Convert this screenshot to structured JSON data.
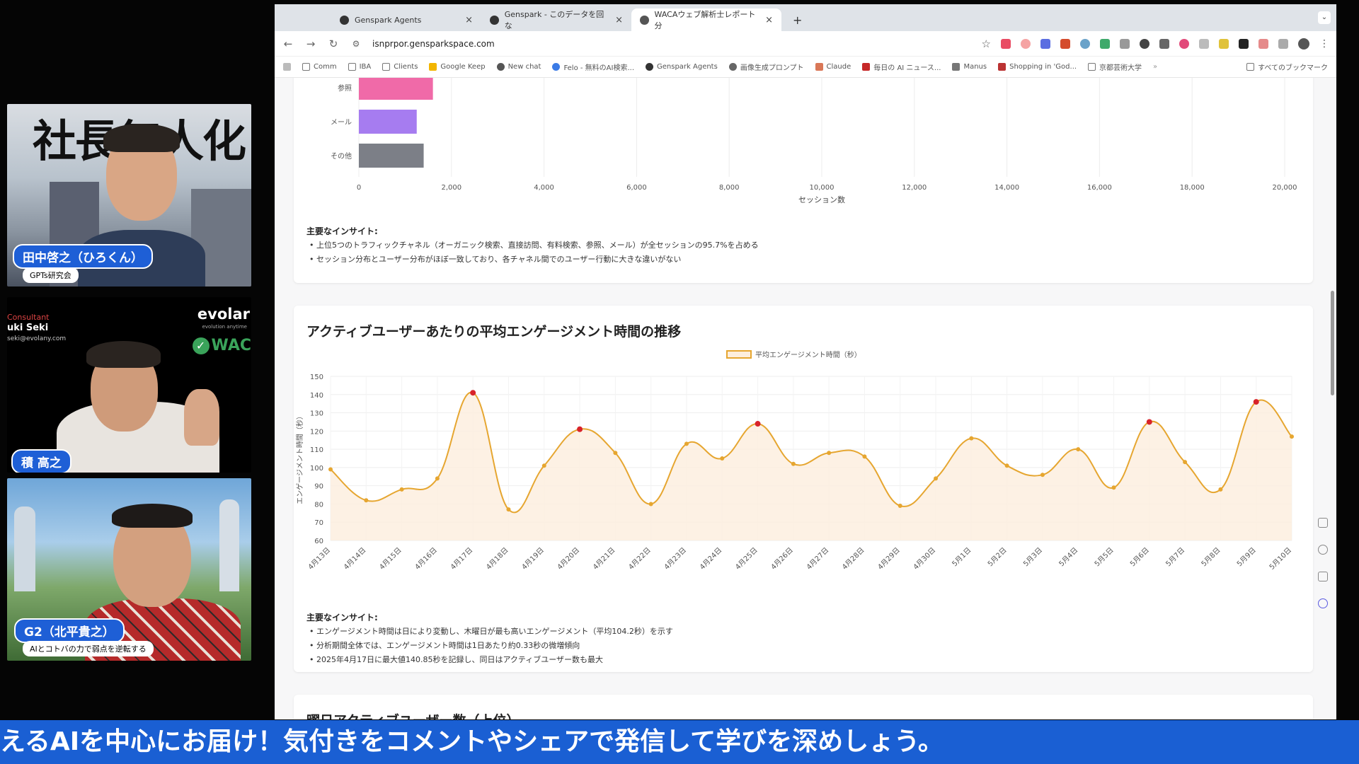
{
  "participants": [
    {
      "name": "田中啓之（ひろくん）",
      "subtitle": "GPTs研究会",
      "bg_text": "社長無人化"
    },
    {
      "name": "積 高之",
      "brand": "evolar",
      "brand_tagline": "evolution anytime",
      "role": "Consultant",
      "person": "uki Seki",
      "email": "seki@evolany.com",
      "wac": "WAC"
    },
    {
      "name": "G2（北平貴之）",
      "subtitle": "AIとコトバの力で弱点を逆転する"
    }
  ],
  "browser": {
    "tabs": [
      {
        "label": "Genspark Agents",
        "active": false
      },
      {
        "label": "Genspark - このデータを回な",
        "active": false
      },
      {
        "label": "WACAウェブ解析士レポート分",
        "active": true
      }
    ],
    "new_tab": "+",
    "url": "isnprpor.gensparkspace.com",
    "bookmarks": [
      "Comm",
      "IBA",
      "Clients",
      "Google Keep",
      "New chat",
      "Felo - 無料のAI検索...",
      "Genspark Agents",
      "画像生成プロンプト",
      "Claude",
      "毎日の AI ニュース...",
      "Manus",
      "Shopping in 'God...",
      "京都芸術大学",
      "すべてのブックマーク"
    ]
  },
  "card1": {
    "insight_title": "主要なインサイト:",
    "insights": [
      "上位5つのトラフィックチャネル（オーガニック検索、直接訪問、有料検索、参照、メール）が全セッションの95.7%を占める",
      "セッション分布とユーザー分布がほぼ一致しており、各チャネル間でのユーザー行動に大きな違いがない"
    ]
  },
  "card2": {
    "title": "アクティブユーザーあたりの平均エンゲージメント時間の推移",
    "insight_title": "主要なインサイト:",
    "insights": [
      "エンゲージメント時間は日により変動し、木曜日が最も高いエンゲージメント（平均104.2秒）を示す",
      "分析期間全体では、エンゲージメント時間は1日あたり約0.33秒の微増傾向",
      "2025年4月17日に最大値140.85秒を記録し、同日はアクティブユーザー数も最大"
    ]
  },
  "card3": {
    "title": "曜日アクティブユーザー数（上位）"
  },
  "ticker": "えるAIを中心にお届け！気付きをコメントやシェアで発信して学びを深めしょう。",
  "chart_data": [
    {
      "type": "bar",
      "orientation": "horizontal",
      "categories": [
        "参照",
        "メール",
        "その他"
      ],
      "values": [
        1600,
        1250,
        1400
      ],
      "colors": [
        "#f06aa8",
        "#a67cf0",
        "#7c7f87"
      ],
      "xlabel": "セッション数",
      "xlim": [
        0,
        20000
      ],
      "xticks": [
        "0",
        "2,000",
        "4,000",
        "6,000",
        "8,000",
        "10,000",
        "12,000",
        "14,000",
        "16,000",
        "18,000",
        "20,000"
      ],
      "grid": true
    },
    {
      "type": "area",
      "legend": "平均エンゲージメント時間（秒）",
      "legend_position": "top-center",
      "ylabel": "エンゲージメント時間（秒）",
      "ylim": [
        60,
        150
      ],
      "yticks": [
        60,
        70,
        80,
        90,
        100,
        110,
        120,
        130,
        140,
        150
      ],
      "categories": [
        "4月13日",
        "4月14日",
        "4月15日",
        "4月16日",
        "4月17日",
        "4月18日",
        "4月19日",
        "4月20日",
        "4月21日",
        "4月22日",
        "4月23日",
        "4月24日",
        "4月25日",
        "4月26日",
        "4月27日",
        "4月28日",
        "4月29日",
        "4月30日",
        "5月1日",
        "5月2日",
        "5月3日",
        "5月4日",
        "5月5日",
        "5月6日",
        "5月7日",
        "5月8日",
        "5月9日",
        "5月10日"
      ],
      "values": [
        99,
        82,
        88,
        94,
        141,
        77,
        101,
        121,
        108,
        80,
        113,
        105,
        124,
        102,
        108,
        106,
        79,
        94,
        116,
        101,
        96,
        110,
        89,
        125,
        103,
        88,
        136,
        117
      ],
      "highlight_indices": [
        4,
        7,
        12,
        23,
        26
      ],
      "line_color": "#e6a630",
      "fill_color": "#fdeedd",
      "highlight_color": "#d8232a",
      "grid": true
    }
  ]
}
